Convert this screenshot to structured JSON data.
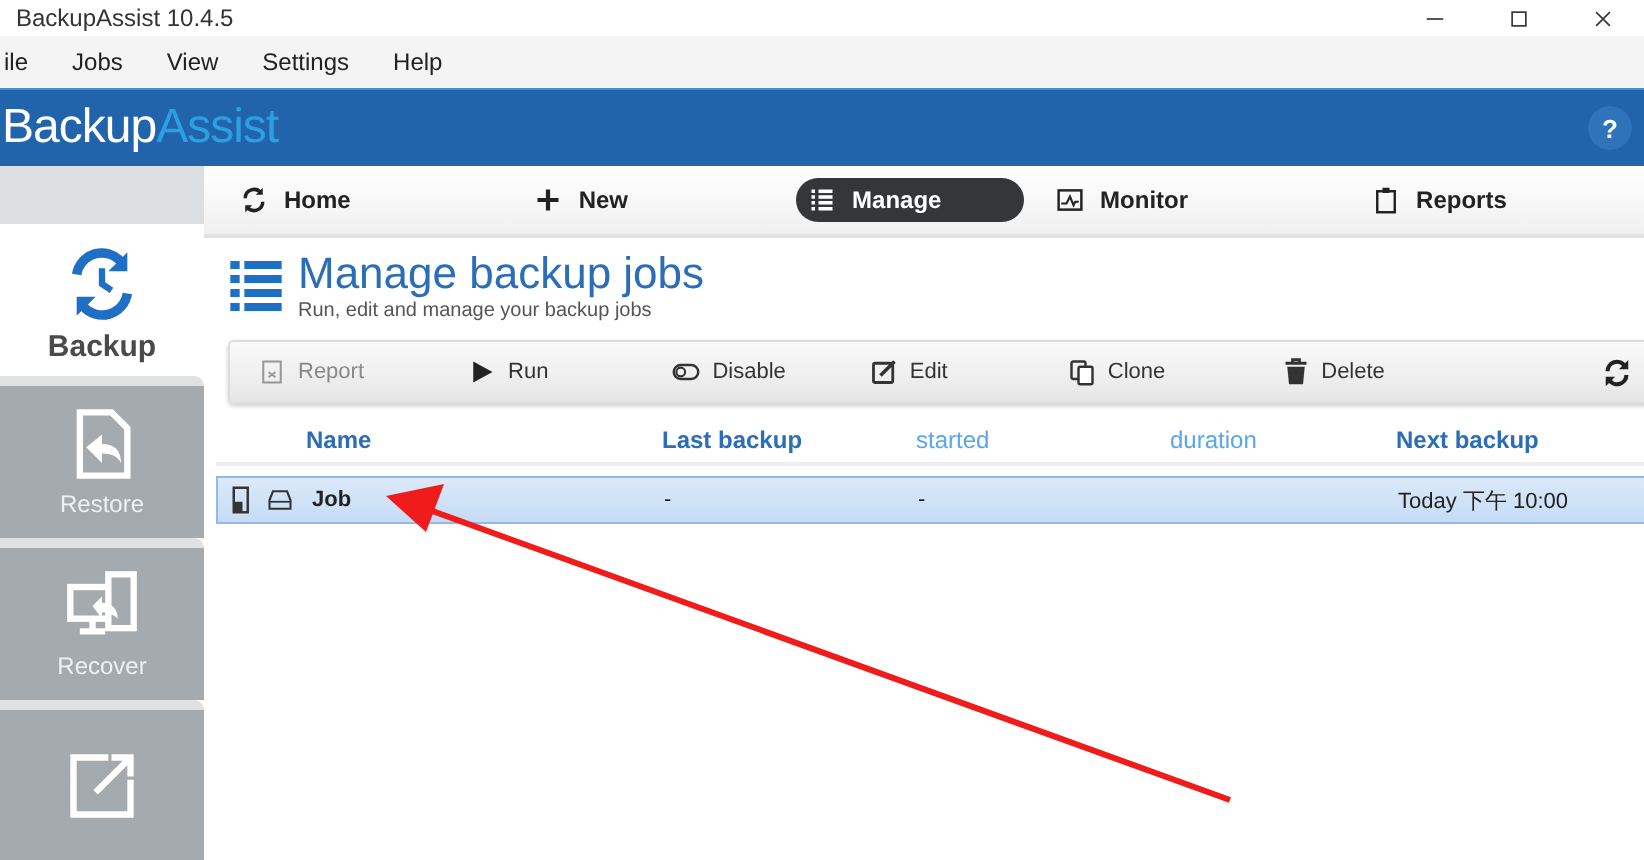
{
  "window": {
    "title": "BackupAssist 10.4.5"
  },
  "menu": [
    "ile",
    "Jobs",
    "View",
    "Settings",
    "Help"
  ],
  "banner": {
    "logo_primary": "Backup",
    "logo_secondary": "Assist",
    "help": "?"
  },
  "nav_tabs": [
    {
      "label": "Home",
      "selected": false
    },
    {
      "label": "New",
      "selected": false
    },
    {
      "label": "Manage",
      "selected": true
    },
    {
      "label": "Monitor",
      "selected": false
    },
    {
      "label": "Reports",
      "selected": false
    }
  ],
  "sidebar": {
    "items": [
      {
        "label": "Backup",
        "selected": true
      },
      {
        "label": "Restore",
        "selected": false
      },
      {
        "label": "Recover",
        "selected": false
      },
      {
        "selected": false
      }
    ]
  },
  "page": {
    "title": "Manage backup jobs",
    "subtitle": "Run, edit and manage your backup jobs"
  },
  "toolbar": [
    {
      "label": "Report",
      "disabled": true
    },
    {
      "label": "Run",
      "disabled": false
    },
    {
      "label": "Disable",
      "disabled": false
    },
    {
      "label": "Edit",
      "disabled": false
    },
    {
      "label": "Clone",
      "disabled": false
    },
    {
      "label": "Delete",
      "disabled": false
    }
  ],
  "table": {
    "columns": [
      {
        "label": "Name",
        "kind": "primary"
      },
      {
        "label": "Last backup",
        "kind": "primary"
      },
      {
        "label": "started",
        "kind": "secondary"
      },
      {
        "label": "duration",
        "kind": "secondary"
      },
      {
        "label": "Next backup",
        "kind": "primary"
      }
    ],
    "rows": [
      {
        "selected": true,
        "cells": {
          "0": "Job",
          "1": "-",
          "2": "-",
          "4": "Today 下午 10:00"
        }
      }
    ]
  }
}
